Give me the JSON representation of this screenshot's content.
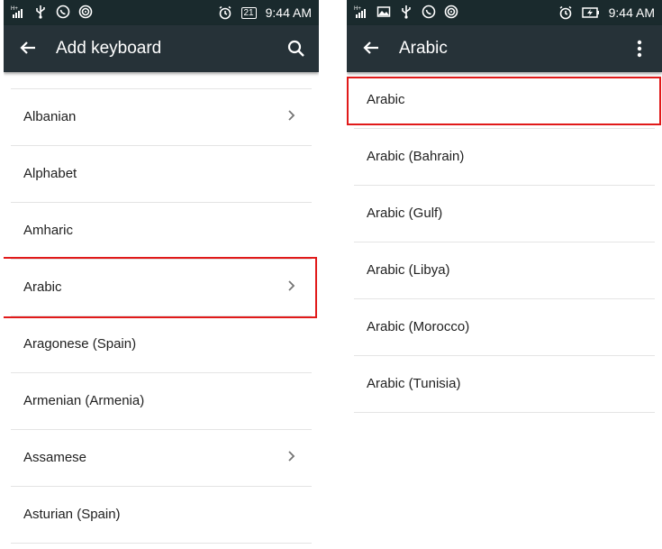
{
  "colors": {
    "status_bar_bg": "#1a2a2d",
    "app_bar_bg": "#263238",
    "divider": "#e4e4e4",
    "highlight": "#e11a1a",
    "text": "#212121"
  },
  "left_screen": {
    "status_bar": {
      "time": "9:44 AM",
      "battery": "21",
      "icons_left": [
        "signal-icon",
        "usb-icon",
        "whatsapp-icon",
        "hotspot-icon"
      ],
      "icons_right": [
        "alarm-icon",
        "battery-icon"
      ]
    },
    "app_bar": {
      "title": "Add keyboard",
      "back_icon": "arrow-back-icon",
      "action_icon": "search-icon"
    },
    "items": [
      {
        "label": "Albanian",
        "has_chevron": true
      },
      {
        "label": "Alphabet",
        "has_chevron": false
      },
      {
        "label": "Amharic",
        "has_chevron": false
      },
      {
        "label": "Arabic",
        "has_chevron": true,
        "highlighted": true
      },
      {
        "label": "Aragonese (Spain)",
        "has_chevron": false
      },
      {
        "label": "Armenian (Armenia)",
        "has_chevron": false
      },
      {
        "label": "Assamese",
        "has_chevron": true
      },
      {
        "label": "Asturian (Spain)",
        "has_chevron": false
      }
    ]
  },
  "right_screen": {
    "status_bar": {
      "time": "9:44 AM",
      "icons_left": [
        "signal-icon",
        "image-icon",
        "usb-icon",
        "whatsapp-icon",
        "hotspot-icon"
      ],
      "icons_right": [
        "alarm-icon",
        "battery-charging-icon"
      ]
    },
    "app_bar": {
      "title": "Arabic",
      "back_icon": "arrow-back-icon",
      "action_icon": "more-vert-icon"
    },
    "items": [
      {
        "label": "Arabic",
        "highlighted": true
      },
      {
        "label": "Arabic (Bahrain)"
      },
      {
        "label": "Arabic (Gulf)"
      },
      {
        "label": "Arabic (Libya)"
      },
      {
        "label": "Arabic (Morocco)"
      },
      {
        "label": "Arabic (Tunisia)"
      }
    ]
  }
}
